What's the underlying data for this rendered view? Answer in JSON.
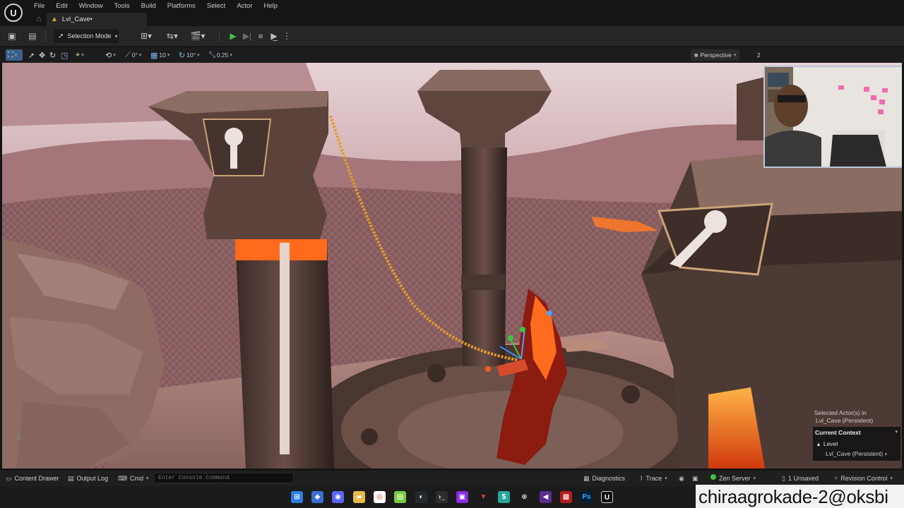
{
  "menu": {
    "items": [
      "File",
      "Edit",
      "Window",
      "Tools",
      "Build",
      "Platforms",
      "Select",
      "Actor",
      "Help"
    ]
  },
  "tab": {
    "label": "Lvl_Cave•"
  },
  "toolbar": {
    "selection_mode": "Selection Mode"
  },
  "viewport_toolbar": {
    "rotate_snap_value": "0°",
    "grid_snap_value": "10",
    "angle_snap_value": "10°",
    "scale_snap_value": "0.25",
    "view_mode": "Perspective",
    "layout_count": "2"
  },
  "viewport_overlay": {
    "selected_line1": "Selected Actor(s) in",
    "selected_line2": "Lvl_Cave (Persistent)",
    "context_title": "Current Context",
    "context_level": "Level",
    "context_level_value": "Lvl_Cave (Persistent)"
  },
  "statusbar": {
    "content_drawer": "Content Drawer",
    "output_log": "Output Log",
    "cmd": "Cmd",
    "console_placeholder": "Enter Console Command",
    "diagnostics": "Diagnostics",
    "trace": "Trace",
    "zen_server": "Zen Server",
    "unsaved": "1 Unsaved",
    "revision_control": "Revision Control"
  },
  "watermark": "chiraagrokade-2@oksbi",
  "colors": {
    "accent_blue": "#3a5f8a",
    "play_green": "#45c047",
    "level_orange": "#e3a13a",
    "lava": "#ff5a14"
  }
}
